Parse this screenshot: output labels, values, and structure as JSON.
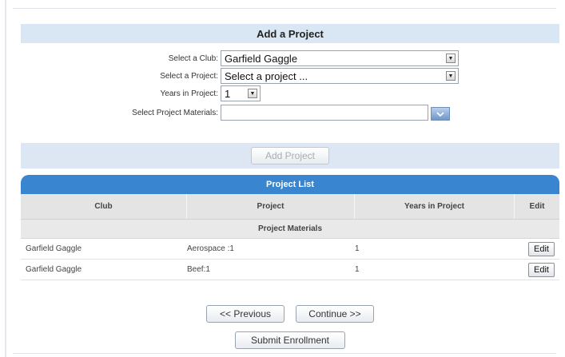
{
  "add_project": {
    "title": "Add a Project",
    "club_label": "Select a Club:",
    "club_value": "Garfield Gaggle",
    "project_label": "Select a Project:",
    "project_value": "Select a project ...",
    "years_label": "Years in Project:",
    "years_value": "1",
    "materials_label": "Select Project Materials:",
    "materials_value": "",
    "add_button": "Add Project"
  },
  "project_list": {
    "title": "Project List",
    "columns": [
      "Club",
      "Project",
      "Years in Project",
      "Edit"
    ],
    "sub_header": "Project Materials",
    "rows": [
      {
        "club": "Garfield Gaggle",
        "project": "Aerospace :1",
        "years": "1",
        "edit": "Edit"
      },
      {
        "club": "Garfield Gaggle",
        "project": "Beef:1",
        "years": "1",
        "edit": "Edit"
      }
    ]
  },
  "navigation": {
    "previous": "<< Previous",
    "continue": "Continue >>",
    "submit": "Submit Enrollment"
  },
  "colors": {
    "header_band": "#d9e6f4",
    "list_header": "#3a85cf"
  }
}
